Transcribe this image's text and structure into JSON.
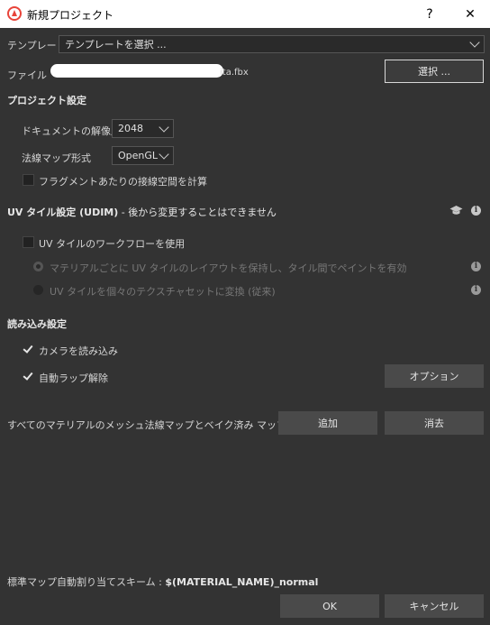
{
  "window": {
    "title": "新規プロジェクト",
    "help_label": "?",
    "close_label": "✕"
  },
  "template": {
    "label": "テンプレート",
    "value": "テンプレートを選択 ..."
  },
  "file": {
    "label": "ファイル",
    "path_visible": "ita.fbx",
    "select_label": "選択 ..."
  },
  "project_settings": {
    "heading": "プロジェクト設定",
    "resolution_label": "ドキュメントの解像度",
    "resolution_value": "2048",
    "normal_format_label": "法線マップ形式",
    "normal_format_value": "OpenGL",
    "fragment_label": "フラグメントあたりの接線空間を計算",
    "fragment_checked": false
  },
  "uv_settings": {
    "heading": "UV タイル設定 (UDIM)",
    "heading_note": " - 後から変更することはできません",
    "workflow_label": "UV タイルのワークフローを使用",
    "workflow_checked": false,
    "option_preserve_label": "マテリアルごとに UV タイルのレイアウトを保持し、タイル間でペイントを有効",
    "option_convert_label": "UV タイルを個々のテクスチャセットに変換 (従来)",
    "info_glyph": "i"
  },
  "import_settings": {
    "heading": "読み込み設定",
    "camera_label": "カメラを読み込み",
    "camera_checked": true,
    "unwrap_label": "自動ラップ解除",
    "unwrap_checked": true,
    "options_label": "オプション"
  },
  "bake": {
    "label": "すべてのマテリアルのメッシュ法線マップとベイク済み マップを読み込み",
    "add_label": "追加",
    "clear_label": "消去"
  },
  "normal_map_scheme": {
    "label": "標準マップ自動割り当てスキーム : ",
    "value": "$(MATERIAL_NAME)_normal"
  },
  "footer": {
    "ok_label": "OK",
    "cancel_label": "キャンセル"
  },
  "colors": {
    "background": "#333333",
    "titlebar": "#ffffff",
    "button": "#4a4a4a",
    "app_icon": "#e8443a"
  },
  "icons": {
    "app": "substance-painter-icon",
    "tutorial": "graduation-cap-icon",
    "info": "info-icon"
  }
}
